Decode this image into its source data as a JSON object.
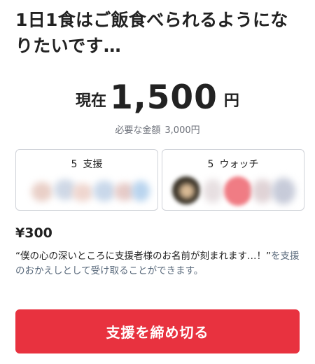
{
  "project": {
    "title": "1日1食はご飯食べられるようになりたいです…"
  },
  "funding": {
    "current_prefix": "現在",
    "current_amount": "1,500",
    "current_unit": "円",
    "required_label": "必要な金額",
    "required_amount": "3,000円"
  },
  "stats": {
    "support_count": "5",
    "support_label": "支援",
    "watch_count": "5",
    "watch_label": "ウォッチ"
  },
  "reward": {
    "price": "¥300",
    "description_quote": "“僕の心の深いところに支援者様のお名前が刻まれます…！”",
    "description_rest": "を支援のおかえしとして受け取ることができます。"
  },
  "actions": {
    "close_support_label": "支援を締め切る"
  },
  "colors": {
    "cta_background": "#e8323f",
    "muted_text": "#6b6f78",
    "card_border": "#cfd2d8"
  }
}
